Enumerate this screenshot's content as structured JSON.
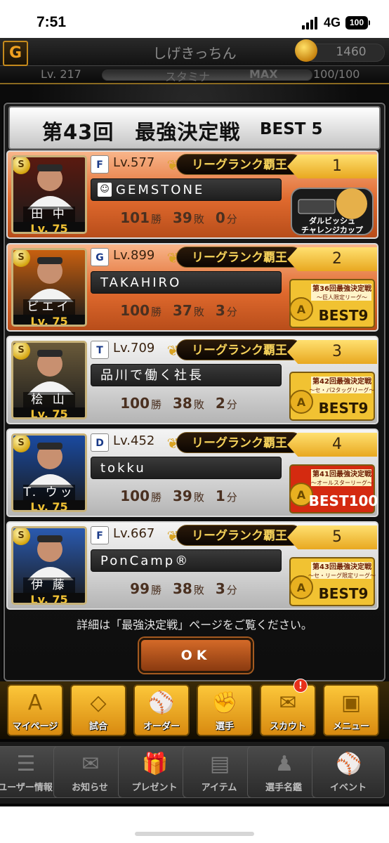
{
  "status_bar": {
    "time": "7:51",
    "network": "4G",
    "battery": "100"
  },
  "header": {
    "player_name": "しげきっちん",
    "coins": "1460",
    "level": "Lv. 217",
    "stamina_label": "スタミナ",
    "stamina_max_label": "MAX",
    "stamina_value": "100/100",
    "stamina_fraction": 1.0
  },
  "modal": {
    "title": "第43回　最強決定戦",
    "title_suffix": "BEST 5",
    "footnote": "詳細は「最強決定戦」ページをご覧ください。",
    "ok_label": "OK"
  },
  "entries": [
    {
      "rank": "1",
      "card_name": "田 中",
      "card_level": "Lv. 75",
      "team": "F",
      "level": "Lv.577",
      "title": "リーグランク覇王",
      "name": "GEMSTONE",
      "name_icon": "☺",
      "wins": "101",
      "losses": "39",
      "draws": "0",
      "win_unit": "勝",
      "loss_unit": "敗",
      "draw_unit": "分",
      "trophy_lines": [
        "ダルビッシュ",
        "チャレンジカップ"
      ],
      "trophy_type": "cup",
      "card_color": "#5a1a10"
    },
    {
      "rank": "2",
      "card_name": "ビエイラ",
      "card_level": "Lv. 75",
      "team": "G",
      "level": "Lv.899",
      "title": "リーグランク覇王",
      "name": "TAKAHIRO",
      "name_icon": "",
      "wins": "100",
      "losses": "37",
      "draws": "3",
      "win_unit": "勝",
      "loss_unit": "敗",
      "draw_unit": "分",
      "trophy_lines": [
        "第36回最強決定戦",
        "〜巨人限定リーグ〜",
        "BEST9"
      ],
      "trophy_type": "medal",
      "card_color": "#c86010"
    },
    {
      "rank": "3",
      "card_name": "桧 山",
      "card_level": "Lv. 75",
      "team": "T",
      "level": "Lv.709",
      "title": "リーグランク覇王",
      "name": "品川で働く社長",
      "name_icon": "",
      "wins": "100",
      "losses": "38",
      "draws": "2",
      "win_unit": "勝",
      "loss_unit": "敗",
      "draw_unit": "分",
      "trophy_lines": [
        "第42回最強決定戦",
        "〜セ・パ2タッグリーグ〜",
        "BEST9"
      ],
      "trophy_type": "medal",
      "card_color": "#6a5a3a"
    },
    {
      "rank": "4",
      "card_name": "T. ウッズ",
      "card_level": "Lv. 75",
      "team": "D",
      "level": "Lv.452",
      "title": "リーグランク覇王",
      "name": "tokku",
      "name_icon": "",
      "wins": "100",
      "losses": "39",
      "draws": "1",
      "win_unit": "勝",
      "loss_unit": "敗",
      "draw_unit": "分",
      "trophy_lines": [
        "第41回最強決定戦",
        "〜オールスターリーグ〜",
        "BEST100"
      ],
      "trophy_type": "medal-red",
      "card_color": "#1a4aa0"
    },
    {
      "rank": "5",
      "card_name": "伊 藤",
      "card_level": "Lv. 75",
      "team": "F",
      "level": "Lv.667",
      "title": "リーグランク覇王",
      "name": "PonCamp®",
      "name_icon": "",
      "wins": "99",
      "losses": "38",
      "draws": "3",
      "win_unit": "勝",
      "loss_unit": "敗",
      "draw_unit": "分",
      "trophy_lines": [
        "第43回最強決定戦",
        "〜セ・リーグ限定リーグ〜",
        "BEST9"
      ],
      "trophy_type": "medal",
      "card_color": "#2a5ab0"
    }
  ],
  "nav_primary": [
    {
      "label": "マイページ",
      "icon": "A"
    },
    {
      "label": "試合",
      "icon": "◇"
    },
    {
      "label": "オーダー",
      "icon": "⚾"
    },
    {
      "label": "選手",
      "icon": "✊"
    },
    {
      "label": "スカウト",
      "icon": "✉"
    },
    {
      "label": "メニュー",
      "icon": "▣"
    }
  ],
  "scout_badge": "!",
  "nav_secondary": [
    {
      "label": "ユーザー情報",
      "icon": "☰"
    },
    {
      "label": "お知らせ",
      "icon": "✉"
    },
    {
      "label": "プレゼント",
      "icon": "🎁"
    },
    {
      "label": "アイテム",
      "icon": "▤"
    },
    {
      "label": "選手名鑑",
      "icon": "♟"
    },
    {
      "label": "イベント",
      "icon": "⚾"
    }
  ]
}
